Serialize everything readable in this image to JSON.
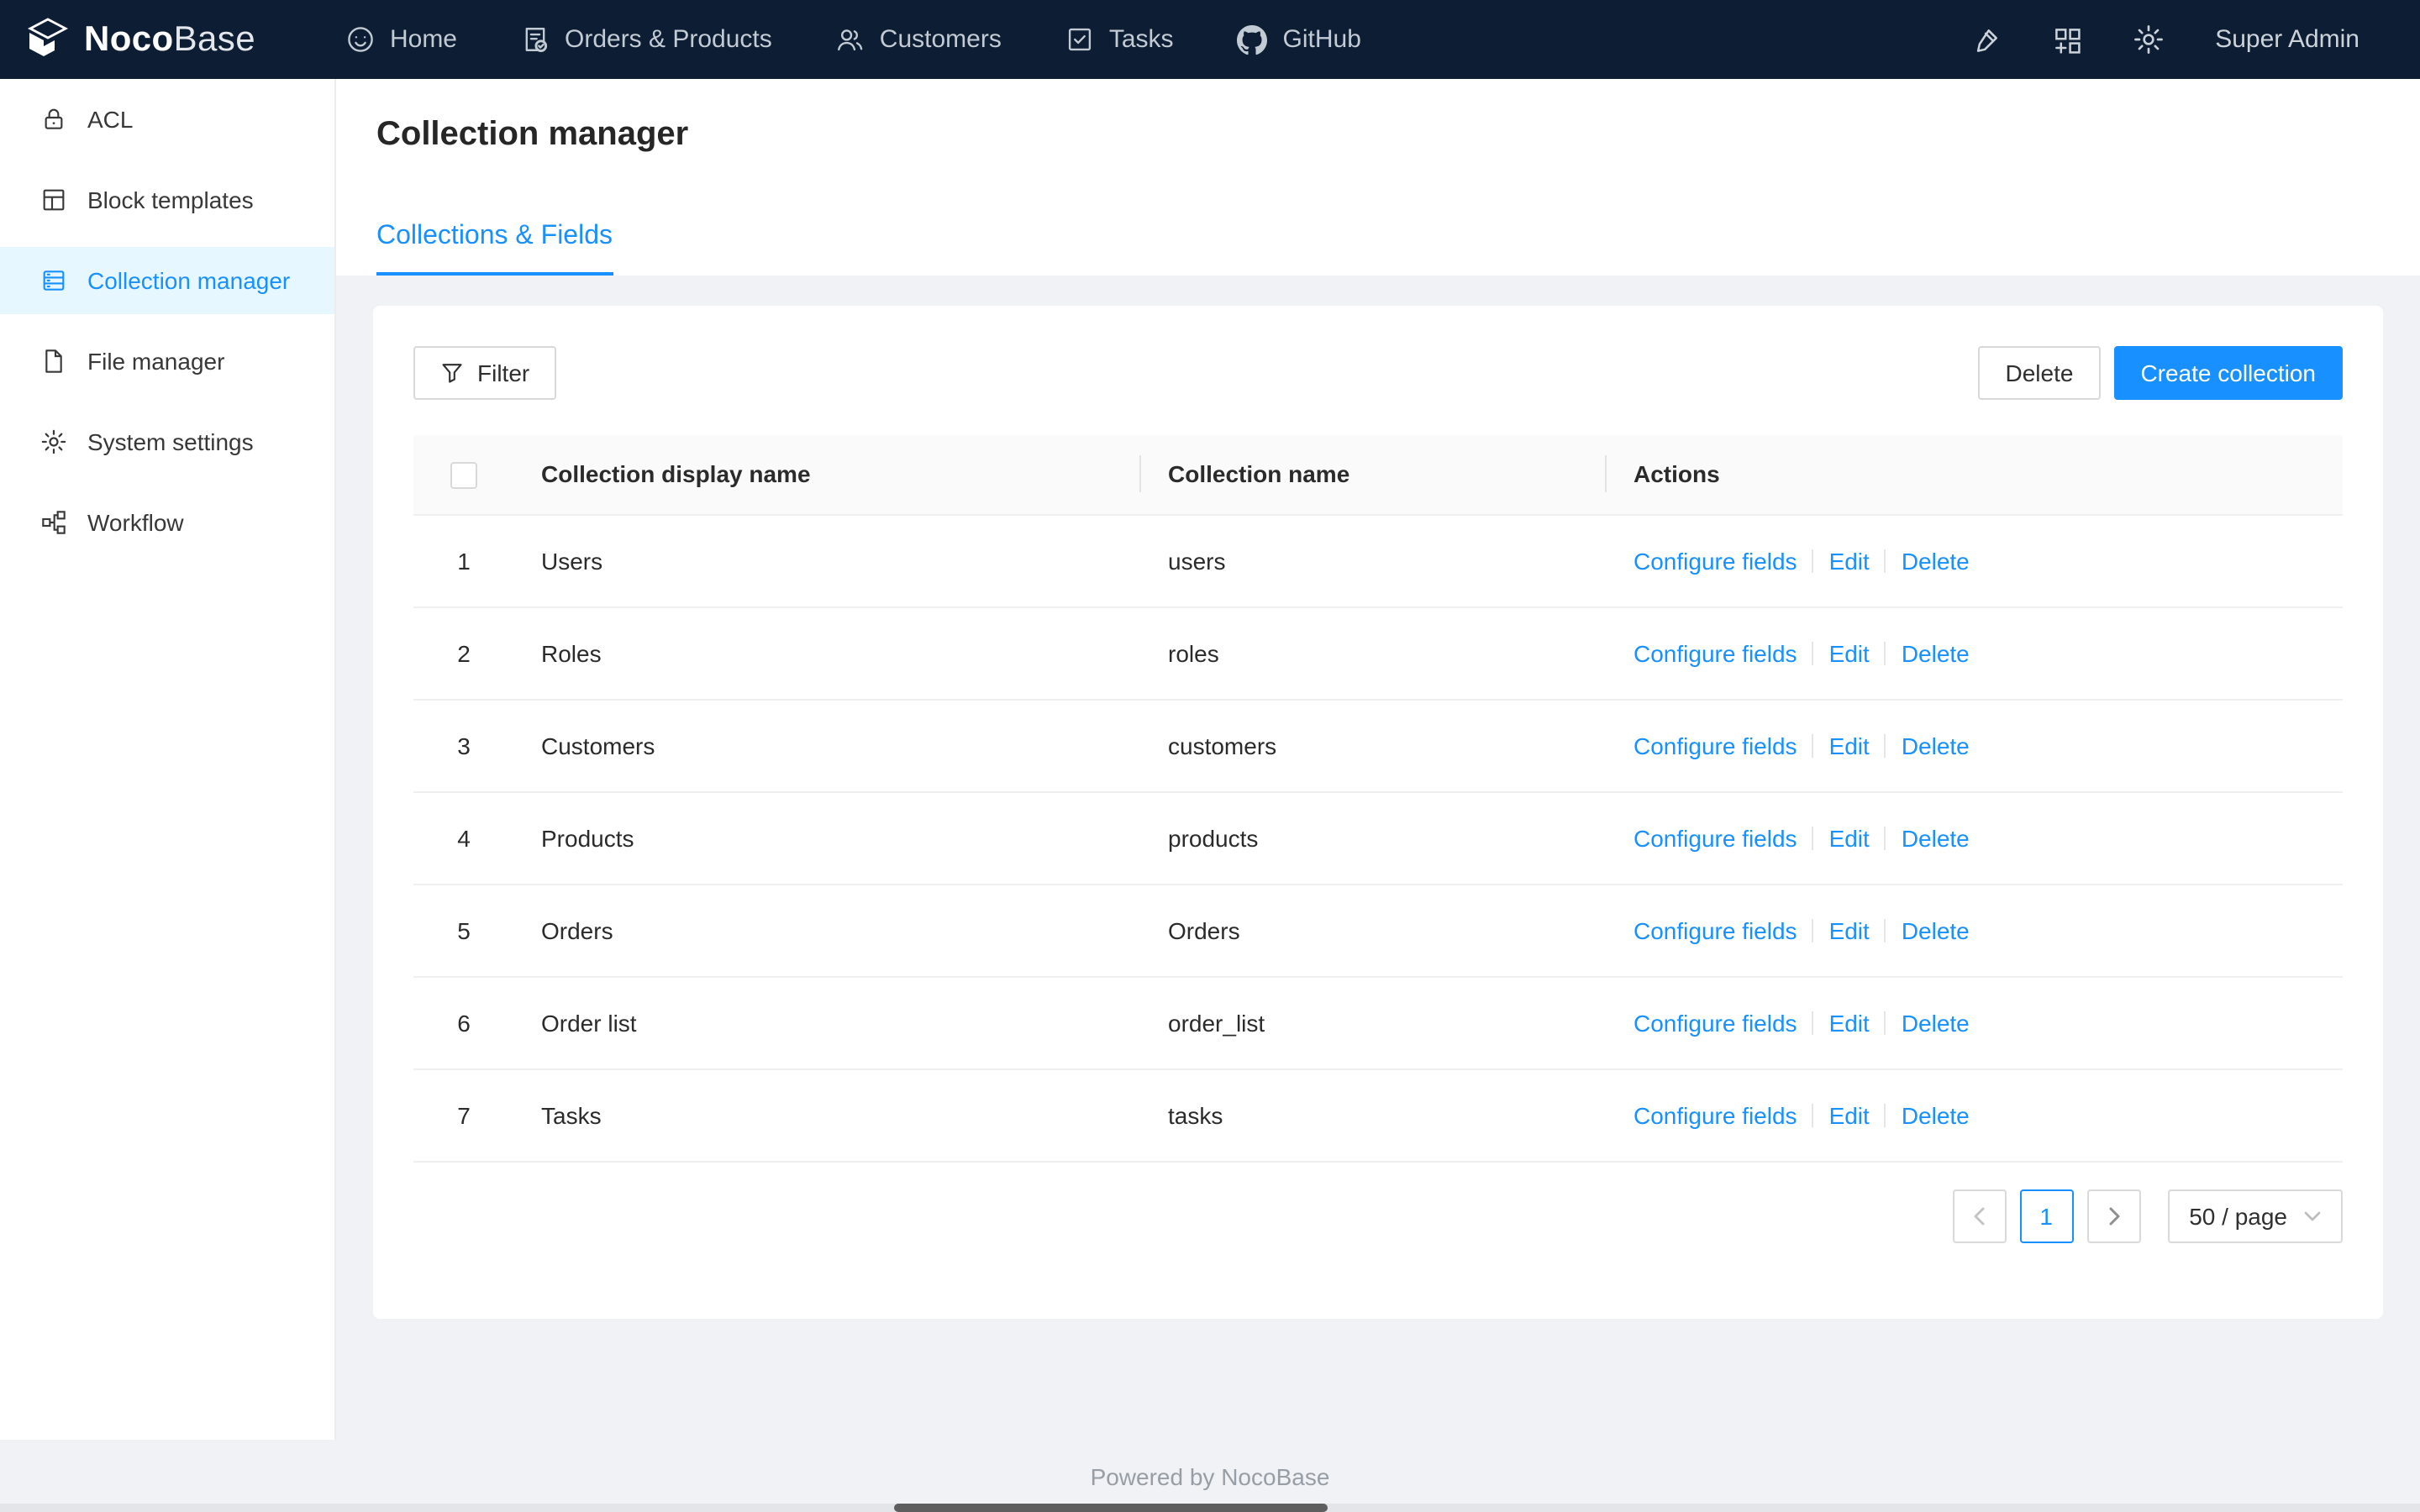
{
  "navbar": {
    "logo_primary": "Noco",
    "logo_secondary": "Base",
    "items": [
      {
        "label": "Home",
        "icon": "smile-icon"
      },
      {
        "label": "Orders & Products",
        "icon": "file-done-icon"
      },
      {
        "label": "Customers",
        "icon": "team-icon"
      },
      {
        "label": "Tasks",
        "icon": "check-square-icon"
      },
      {
        "label": "GitHub",
        "icon": "github-icon"
      }
    ],
    "user": "Super Admin"
  },
  "sidebar": {
    "items": [
      {
        "label": "ACL",
        "icon": "lock-icon"
      },
      {
        "label": "Block templates",
        "icon": "layout-icon"
      },
      {
        "label": "Collection manager",
        "icon": "collections-icon"
      },
      {
        "label": "File manager",
        "icon": "file-icon"
      },
      {
        "label": "System settings",
        "icon": "gear-icon"
      },
      {
        "label": "Workflow",
        "icon": "workflow-icon"
      }
    ]
  },
  "page": {
    "title": "Collection manager",
    "active_tab": "Collections & Fields"
  },
  "toolbar": {
    "filter_label": "Filter",
    "delete_label": "Delete",
    "create_label": "Create collection"
  },
  "table": {
    "columns": [
      "Collection display name",
      "Collection name",
      "Actions"
    ],
    "action_labels": [
      "Configure fields",
      "Edit",
      "Delete"
    ],
    "rows": [
      {
        "index": "1",
        "display_name": "Users",
        "name": "users"
      },
      {
        "index": "2",
        "display_name": "Roles",
        "name": "roles"
      },
      {
        "index": "3",
        "display_name": "Customers",
        "name": "customers"
      },
      {
        "index": "4",
        "display_name": "Products",
        "name": "products"
      },
      {
        "index": "5",
        "display_name": "Orders",
        "name": "Orders"
      },
      {
        "index": "6",
        "display_name": "Order list",
        "name": "order_list"
      },
      {
        "index": "7",
        "display_name": "Tasks",
        "name": "tasks"
      }
    ]
  },
  "pagination": {
    "current_page": "1",
    "page_size": "50 / page"
  },
  "footer": {
    "text": "Powered by NocoBase"
  },
  "colors": {
    "primary": "#1890ff",
    "navbar_bg": "#0d1d33",
    "sidebar_active_bg": "#e6f7ff",
    "content_bg": "#f0f2f5"
  }
}
